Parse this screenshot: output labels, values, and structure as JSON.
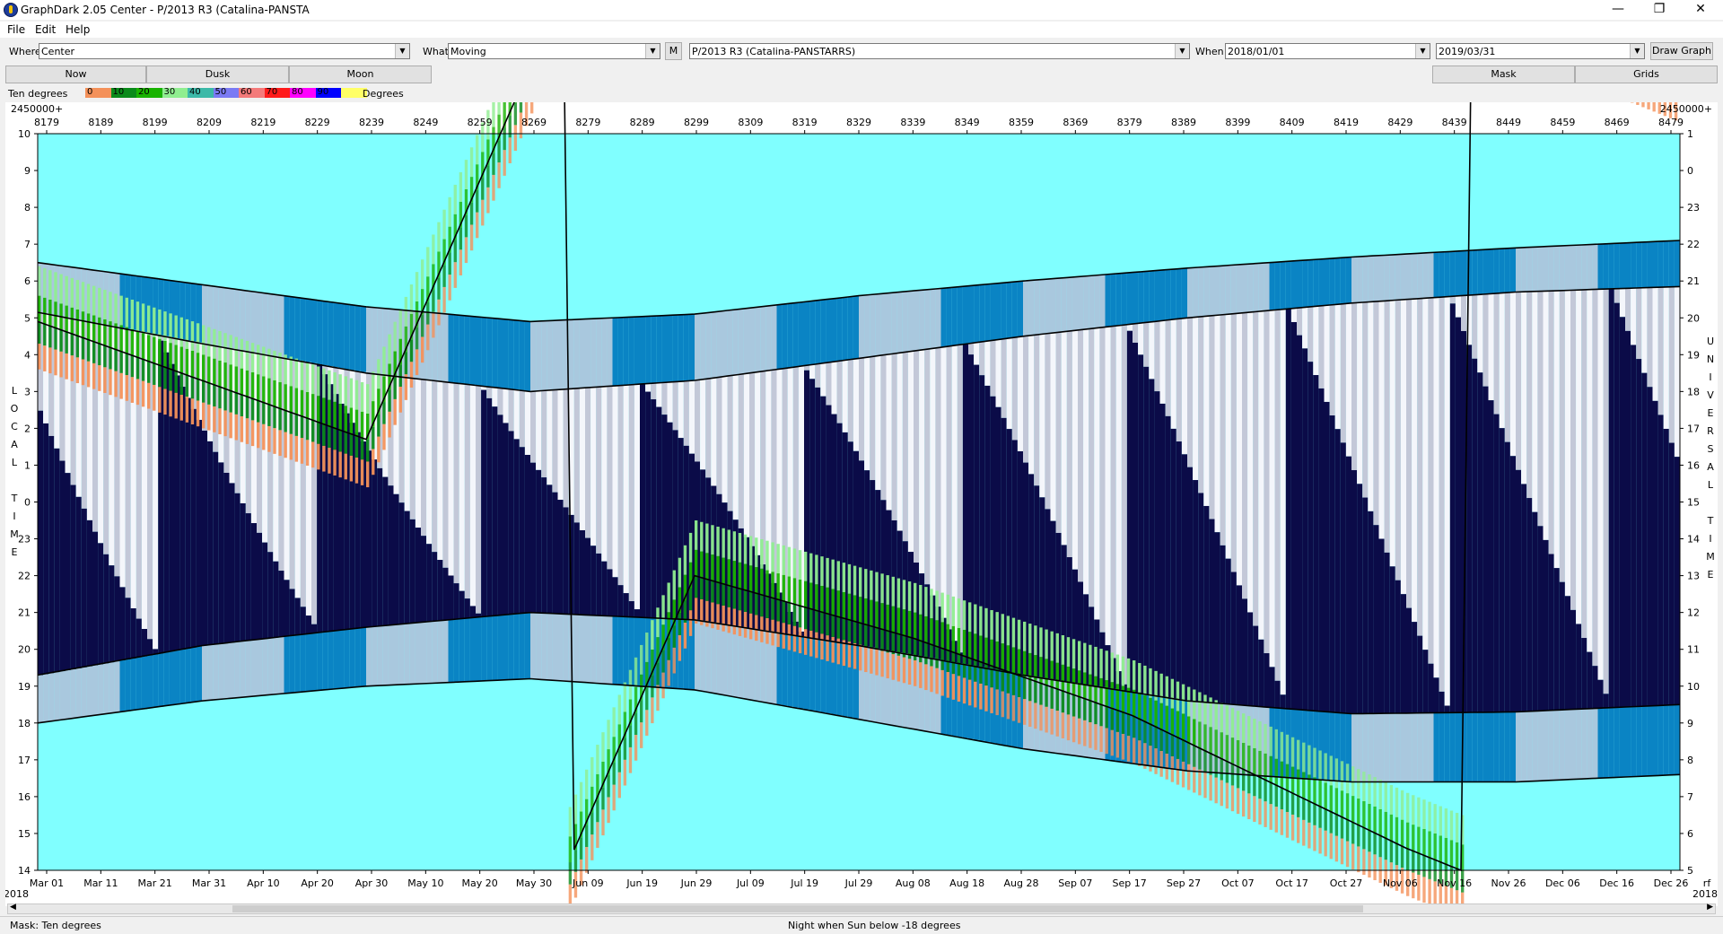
{
  "window": {
    "title": "GraphDark 2.05  Center  -  P/2013 R3 (Catalina-PANSTA",
    "min_glyph": "—",
    "max_glyph": "❐",
    "close_glyph": "✕"
  },
  "menu": {
    "file": "File",
    "edit": "Edit",
    "help": "Help"
  },
  "toolbar": {
    "where_label": "Where",
    "where_value": "Center",
    "what_label": "What",
    "what_value": "Moving",
    "m_button": "M",
    "object_value": "P/2013 R3 (Catalina-PANSTARRS)",
    "when_label": "When",
    "start_date": "2018/01/01",
    "end_date": "2019/03/31",
    "draw_button": "Draw Graph"
  },
  "buttons": {
    "now": "Now",
    "dusk": "Dusk",
    "moon": "Moon",
    "mask": "Mask",
    "grids": "Grids"
  },
  "legend": {
    "label": "Ten degrees",
    "units": "Degrees",
    "swatches": [
      {
        "text": "0",
        "color": "#f4915a"
      },
      {
        "text": "10",
        "color": "#0a8a1a"
      },
      {
        "text": "20",
        "color": "#19b300"
      },
      {
        "text": "30",
        "color": "#90ee90"
      },
      {
        "text": "40",
        "color": "#3cb9a8"
      },
      {
        "text": "50",
        "color": "#7a7af4"
      },
      {
        "text": "60",
        "color": "#f47a7a"
      },
      {
        "text": "70",
        "color": "#ff1a1a"
      },
      {
        "text": "80",
        "color": "#ff00ff"
      },
      {
        "text": "90",
        "color": "#0000ff"
      },
      {
        "text": "",
        "color": "#ffff66"
      }
    ]
  },
  "chart_data": {
    "type": "heatmap",
    "jd_prefix": "2450000+",
    "jd_ticks": [
      "8179",
      "8189",
      "8199",
      "8209",
      "8219",
      "8229",
      "8239",
      "8249",
      "8259",
      "8269",
      "8279",
      "8289",
      "8299",
      "8309",
      "8319",
      "8329",
      "8339",
      "8349",
      "8359",
      "8369",
      "8379",
      "8389",
      "8399",
      "8409",
      "8419",
      "8429",
      "8439",
      "8449",
      "8459",
      "8469",
      "8479"
    ],
    "date_ticks": [
      "Mar 01",
      "Mar 11",
      "Mar 21",
      "Mar 31",
      "Apr 10",
      "Apr 20",
      "Apr 30",
      "May 10",
      "May 20",
      "May 30",
      "Jun 09",
      "Jun 19",
      "Jun 29",
      "Jul 09",
      "Jul 19",
      "Jul 29",
      "Aug 08",
      "Aug 18",
      "Aug 28",
      "Sep 07",
      "Sep 17",
      "Sep 27",
      "Oct 07",
      "Oct 17",
      "Oct 27",
      "Nov 06",
      "Nov 16",
      "Nov 26",
      "Dec 06",
      "Dec 16",
      "Dec 26"
    ],
    "year_left": "2018",
    "year_right": "2018",
    "x_end_mark": "rf",
    "left_axis_label": "LOCAL TIME",
    "right_axis_label": "UNIVERSAL TIME",
    "left_ticks": [
      "10",
      "9",
      "8",
      "7",
      "6",
      "5",
      "4",
      "3",
      "2",
      "1",
      "0",
      "23",
      "22",
      "21",
      "20",
      "19",
      "18",
      "17",
      "16",
      "15",
      "14"
    ],
    "right_ticks": [
      "1",
      "0",
      "23",
      "22",
      "21",
      "20",
      "19",
      "18",
      "17",
      "16",
      "15",
      "14",
      "13",
      "12",
      "11",
      "10",
      "9",
      "8",
      "7",
      "6",
      "5"
    ],
    "dusk_curve_local": [
      [
        0,
        19.3
      ],
      [
        30,
        20.1
      ],
      [
        60,
        20.6
      ],
      [
        90,
        21.0
      ],
      [
        120,
        20.8
      ],
      [
        150,
        20.1
      ],
      [
        180,
        19.3
      ],
      [
        210,
        18.6
      ],
      [
        240,
        18.25
      ],
      [
        270,
        18.3
      ],
      [
        300,
        18.5
      ]
    ],
    "dawn_curve_local": [
      [
        0,
        5.15
      ],
      [
        30,
        4.3
      ],
      [
        60,
        3.5
      ],
      [
        90,
        3.0
      ],
      [
        120,
        3.3
      ],
      [
        150,
        3.9
      ],
      [
        180,
        4.5
      ],
      [
        210,
        5.0
      ],
      [
        240,
        5.4
      ],
      [
        270,
        5.7
      ],
      [
        300,
        5.85
      ]
    ],
    "evening_twilight_curve": [
      [
        0,
        18.0
      ],
      [
        30,
        18.6
      ],
      [
        60,
        19.0
      ],
      [
        90,
        19.2
      ],
      [
        120,
        18.9
      ],
      [
        150,
        18.1
      ],
      [
        180,
        17.3
      ],
      [
        210,
        16.7
      ],
      [
        240,
        16.4
      ],
      [
        270,
        16.4
      ],
      [
        300,
        16.6
      ]
    ],
    "morning_twilight_curve": [
      [
        0,
        6.5
      ],
      [
        30,
        5.9
      ],
      [
        60,
        5.3
      ],
      [
        90,
        4.9
      ],
      [
        120,
        5.1
      ],
      [
        150,
        5.6
      ],
      [
        180,
        6.0
      ],
      [
        210,
        6.35
      ],
      [
        240,
        6.65
      ],
      [
        270,
        6.9
      ],
      [
        300,
        7.1
      ]
    ],
    "object_altitude_band": {
      "description_points_local": [
        [
          0,
          4.9
        ],
        [
          60,
          1.7
        ],
        [
          120,
          22.0
        ],
        [
          160,
          20.3
        ],
        [
          200,
          18.2
        ],
        [
          250,
          14.6
        ],
        [
          300,
          11.6
        ]
      ],
      "legend_reference": "Ten degrees"
    },
    "moon_period_days": 29.5
  },
  "status": {
    "mask": "Mask:  Ten degrees",
    "night": "Night when Sun below -18 degrees"
  }
}
